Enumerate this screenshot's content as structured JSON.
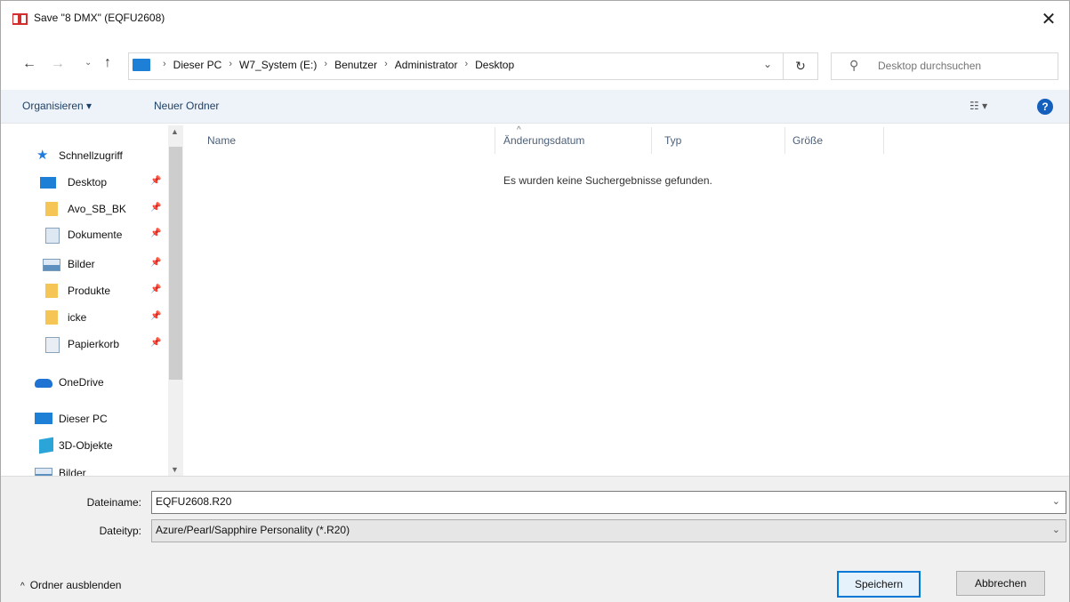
{
  "window": {
    "title": "Save \"8 DMX\" (EQFU2608)"
  },
  "nav": {
    "breadcrumbs": [
      "Dieser PC",
      "W7_System (E:)",
      "Benutzer",
      "Administrator",
      "Desktop"
    ],
    "search_placeholder": "Desktop durchsuchen"
  },
  "toolbar": {
    "organize": "Organisieren ▾",
    "new_folder": "Neuer Ordner"
  },
  "sidebar": {
    "items": [
      {
        "label": "Schnellzugriff",
        "icon": "star-icon"
      },
      {
        "label": "Desktop",
        "icon": "desktop-folder-icon",
        "pinned": true
      },
      {
        "label": "Avo_SB_BK",
        "icon": "folder-icon",
        "pinned": true
      },
      {
        "label": "Dokumente",
        "icon": "documents-icon",
        "pinned": true
      },
      {
        "label": "Bilder",
        "icon": "pictures-icon",
        "pinned": true
      },
      {
        "label": "Produkte",
        "icon": "folder-icon",
        "pinned": true
      },
      {
        "label": "icke",
        "icon": "folder-icon",
        "pinned": true
      },
      {
        "label": "Papierkorb",
        "icon": "recycle-bin-icon",
        "pinned": true
      },
      {
        "label": "OneDrive",
        "icon": "cloud-icon"
      },
      {
        "label": "Dieser PC",
        "icon": "computer-icon"
      },
      {
        "label": "3D-Objekte",
        "icon": "3d-objects-icon"
      },
      {
        "label": "Bilder",
        "icon": "pictures-icon"
      }
    ]
  },
  "columns": [
    "Name",
    "Änderungsdatum",
    "Typ",
    "Größe"
  ],
  "empty_message": "Es wurden keine Suchergebnisse gefunden.",
  "form": {
    "filename_label": "Dateiname:",
    "filename_value": "EQFU2608.R20",
    "filetype_label": "Dateityp:",
    "filetype_value": "Azure/Pearl/Sapphire Personality (*.R20)"
  },
  "footer": {
    "hide_folders": "Ordner ausblenden",
    "save": "Speichern",
    "cancel": "Abbrechen"
  },
  "colors": {
    "accent": "#0078d7",
    "cmdbar": "#eef3f9",
    "footer": "#f0f0f0"
  }
}
